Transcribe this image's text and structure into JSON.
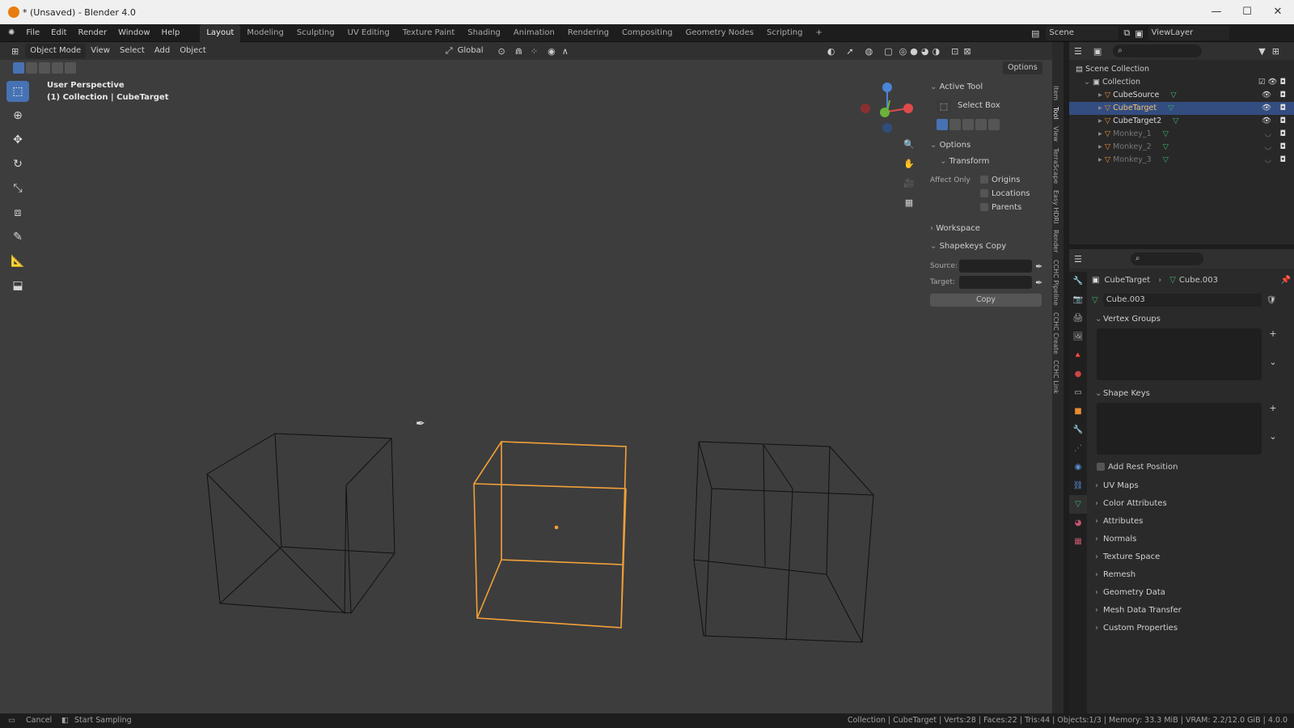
{
  "window": {
    "title": "* (Unsaved) - Blender 4.0",
    "controls": [
      "—",
      "☐",
      "✕"
    ]
  },
  "menu": {
    "items": [
      "File",
      "Edit",
      "Render",
      "Window",
      "Help"
    ],
    "workspaces": [
      "Layout",
      "Modeling",
      "Sculpting",
      "UV Editing",
      "Texture Paint",
      "Shading",
      "Animation",
      "Rendering",
      "Compositing",
      "Geometry Nodes",
      "Scripting"
    ],
    "active_workspace": "Layout",
    "add_tab": "+",
    "scene": "Scene",
    "view_layer": "ViewLayer"
  },
  "viewport": {
    "mode": "Object Mode",
    "header_menus": [
      "View",
      "Select",
      "Add",
      "Object"
    ],
    "orientation": "Global",
    "options": "Options",
    "overlay_title": "User Perspective",
    "overlay_sub": "(1) Collection | CubeTarget",
    "gizmo_axes": [
      "Z",
      "Y",
      "X"
    ],
    "tool_icons": [
      "select-box-icon",
      "cursor-icon",
      "move-icon",
      "rotate-icon",
      "scale-icon",
      "transform-icon",
      "annotate-icon",
      "measure-icon",
      "add-cube-icon"
    ]
  },
  "npanel": {
    "active_tool_header": "Active Tool",
    "active_tool_name": "Select Box",
    "options_header": "Options",
    "transform_header": "Transform",
    "affect_only": "Affect Only",
    "affect_items": [
      "Origins",
      "Locations",
      "Parents"
    ],
    "workspace_header": "Workspace",
    "shapekeys_header": "Shapekeys Copy",
    "source_label": "Source:",
    "target_label": "Target:",
    "copy_button": "Copy",
    "tabs": [
      "Item",
      "Tool",
      "View",
      "TerraScape",
      "Easy HDRI",
      "Render",
      "CCHC Pipeline",
      "CCHC Create",
      "CCHC Link"
    ]
  },
  "outliner": {
    "scene_collection": "Scene Collection",
    "collection": "Collection",
    "objects": [
      {
        "name": "CubeSource",
        "selected": false,
        "dim": false
      },
      {
        "name": "CubeTarget",
        "selected": true,
        "dim": false
      },
      {
        "name": "CubeTarget2",
        "selected": false,
        "dim": false
      },
      {
        "name": "Monkey_1",
        "selected": false,
        "dim": true
      },
      {
        "name": "Monkey_2",
        "selected": false,
        "dim": true
      },
      {
        "name": "Monkey_3",
        "selected": false,
        "dim": true
      }
    ]
  },
  "properties": {
    "breadcrumb_object": "CubeTarget",
    "breadcrumb_mesh": "Cube.003",
    "mesh_name": "Cube.003",
    "vertex_groups": "Vertex Groups",
    "shape_keys": "Shape Keys",
    "add_rest_position": "Add Rest Position",
    "sections": [
      "UV Maps",
      "Color Attributes",
      "Attributes",
      "Normals",
      "Texture Space",
      "Remesh",
      "Geometry Data",
      "Mesh Data Transfer",
      "Custom Properties"
    ]
  },
  "status": {
    "left_items": [
      "Cancel",
      "Start Sampling"
    ],
    "right": "Collection | CubeTarget | Verts:28 | Faces:22 | Tris:44 | Objects:1/3 | Memory: 33.3 MiB | VRAM: 2.2/12.0 GiB | 4.0.0"
  },
  "colors": {
    "accent": "#4772b3",
    "selected_object": "#f2a03a",
    "viewport_bg": "#3d3d3d",
    "panel_bg": "#303030"
  }
}
